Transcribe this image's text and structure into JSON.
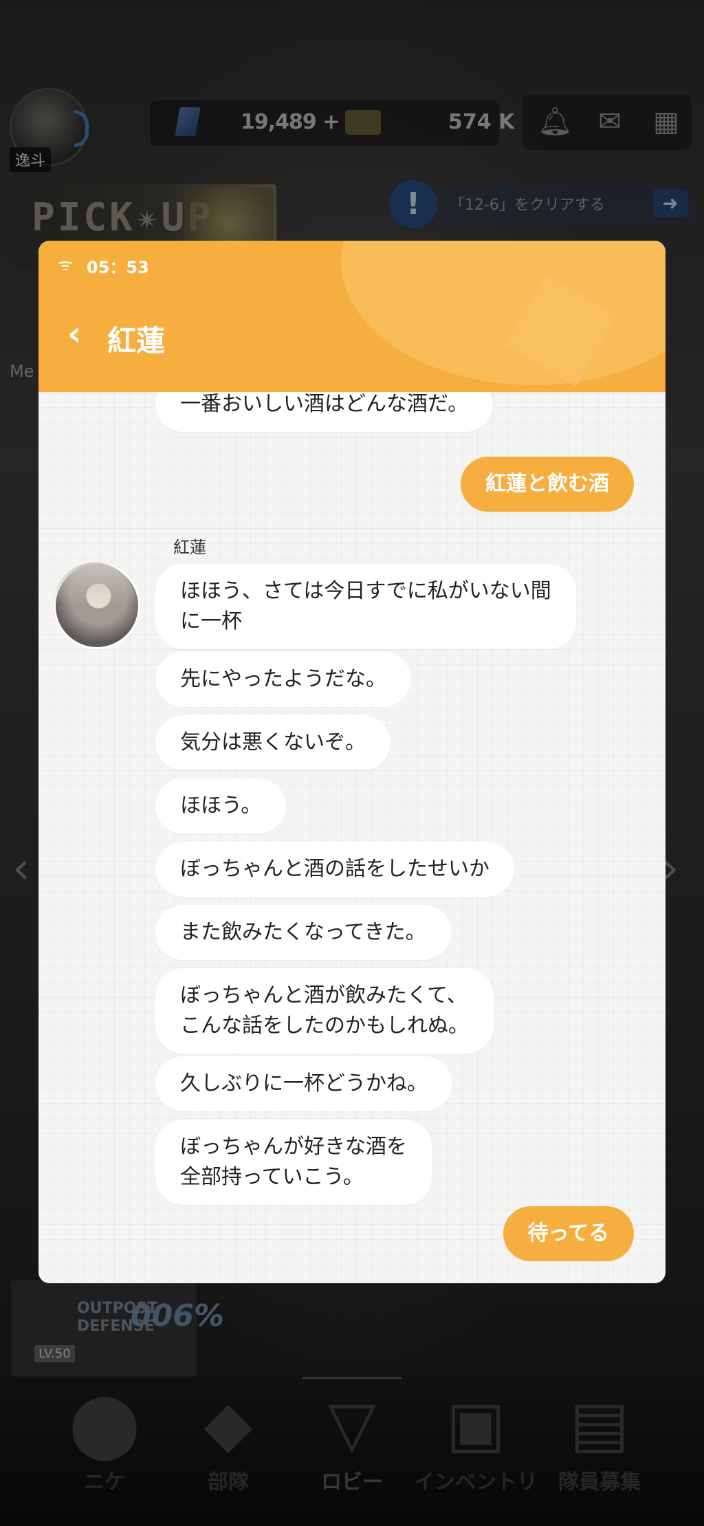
{
  "lobby": {
    "player_name": "逸斗",
    "gems": "19,489 +",
    "credits": "574 K",
    "pickup_banner": "PICK✴UP",
    "mission_text": "「12-6」をクリアする",
    "mission_icon": "!",
    "side_label": "Me",
    "defense_label": "OUTPOST DEFENSE",
    "defense_percent": "006%",
    "defense_level": "LV.50",
    "nav": [
      {
        "label": "ニケ",
        "icon": "nikke-icon"
      },
      {
        "label": "部隊",
        "icon": "squad-icon"
      },
      {
        "label": "ロビー",
        "icon": "lobby-icon"
      },
      {
        "label": "インベントリ",
        "icon": "inventory-icon"
      },
      {
        "label": "隊員募集",
        "icon": "recruit-icon"
      }
    ],
    "active_nav": "ロビー"
  },
  "phone": {
    "status_time": "05：53",
    "chat_title": "紅蓮",
    "header_color": "#f6ae3f"
  },
  "messages": [
    {
      "from": "npc",
      "text": "一番おいしい酒はどんな酒だ。"
    },
    {
      "from": "me",
      "text": "紅蓮と飲む酒"
    },
    {
      "from": "npc_name",
      "text": "紅蓮"
    },
    {
      "from": "npc",
      "text": "ほほう、さては今日すでに私がいない間\nに一杯"
    },
    {
      "from": "npc",
      "text": "先にやったようだな。"
    },
    {
      "from": "npc",
      "text": "気分は悪くないぞ。"
    },
    {
      "from": "npc",
      "text": "ほほう。"
    },
    {
      "from": "npc",
      "text": "ぼっちゃんと酒の話をしたせいか"
    },
    {
      "from": "npc",
      "text": "また飲みたくなってきた。"
    },
    {
      "from": "npc",
      "text": "ぼっちゃんと酒が飲みたくて、\nこんな話をしたのかもしれぬ。"
    },
    {
      "from": "npc",
      "text": "久しぶりに一杯どうかね。"
    },
    {
      "from": "npc",
      "text": "ぼっちゃんが好きな酒を\n全部持っていこう。"
    },
    {
      "from": "me",
      "text": "待ってる"
    }
  ]
}
